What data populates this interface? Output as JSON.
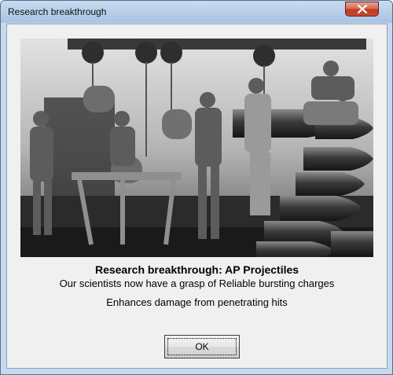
{
  "window": {
    "title": "Research breakthrough"
  },
  "dialog": {
    "heading": "Research breakthrough: AP Projectiles",
    "subline": "Our scientists now have a grasp of Reliable bursting charges",
    "effect": "Enhances damage from penetrating hits",
    "ok_label": "OK"
  },
  "icons": {
    "close": "close-icon"
  },
  "colors": {
    "titlebar": "#b8cfe9",
    "close_button": "#c94a33",
    "client_background": "#f0f0f0"
  }
}
